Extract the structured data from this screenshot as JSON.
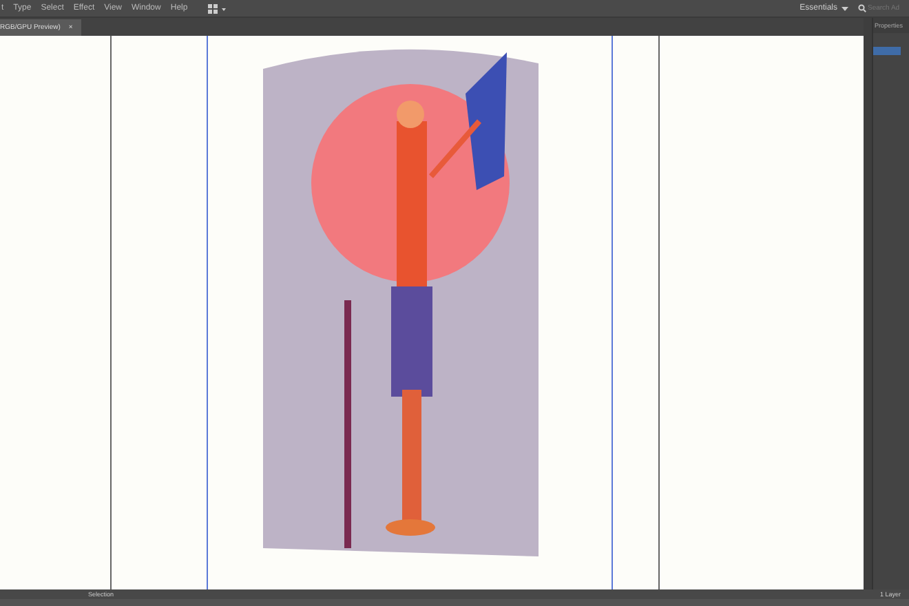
{
  "menu_bar": {
    "items": [
      "t",
      "Type",
      "Select",
      "Effect",
      "View",
      "Window",
      "Help"
    ],
    "workspace": "Essentials",
    "search": {
      "placeholder": "Search Ad"
    }
  },
  "document_tab": {
    "title": "RGB/GPU Preview)",
    "close": "×"
  },
  "properties_panel": {
    "title": "Properties"
  },
  "status_bar": {
    "tool": "Selection",
    "layers": "1 Layer"
  }
}
